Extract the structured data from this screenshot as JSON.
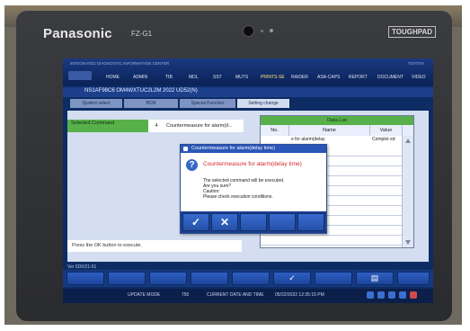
{
  "device": {
    "brand": "Panasonic",
    "model": "FZ-G1",
    "badge": "TOUGHPAD"
  },
  "app": {
    "title": "INTEGRATED DIAGNOSTIC INFORMATION CENTER",
    "top_right": "TOYOTA",
    "tabs": [
      "HOME",
      "ADMIN",
      "TIB",
      "MDL",
      "SST",
      "MUTS",
      "PRINTS-SE",
      "RAIDER",
      "ASA-CAPS",
      "REPORT",
      "DOCUMENT",
      "VIDEO"
    ],
    "active_tab": "PRINTS-SE"
  },
  "vehicle": {
    "text": "NS1AF98C6   OM4WXTUC2L2M 2022   UD52(N)"
  },
  "breadcrumbs": [
    "System select",
    "BCM",
    "Special Function",
    "Setting change"
  ],
  "selected_command": {
    "label": "Selected Command",
    "number": "4",
    "value": "Countermeasure for alarm(d..."
  },
  "data_list": {
    "title": "Data List",
    "columns": [
      "No.",
      "Name",
      "Value"
    ],
    "rows": [
      {
        "no": "",
        "name": "e for alarm(delay",
        "value": "Complet ed"
      },
      {
        "no": "",
        "name": "",
        "value": ""
      },
      {
        "no": "",
        "name": "",
        "value": ""
      },
      {
        "no": "",
        "name": "",
        "value": ""
      },
      {
        "no": "",
        "name": "",
        "value": ""
      },
      {
        "no": "",
        "name": "",
        "value": ""
      },
      {
        "no": "",
        "name": "",
        "value": ""
      },
      {
        "no": "",
        "name": "",
        "value": ""
      },
      {
        "no": "",
        "name": "",
        "value": ""
      },
      {
        "no": "",
        "name": "",
        "value": ""
      }
    ]
  },
  "instruction": "Press the OK button to execute.",
  "dialog": {
    "title": "Countermeasure for alarm(delay time)",
    "heading": "Countermeasure for alarm(delay time)",
    "lines": [
      "The selected command will be executed.",
      "Are you sure?",
      "Caution:",
      "Please check execution conditions."
    ]
  },
  "version": "Ver 5D0/21-01",
  "status": {
    "mode": "UPDATE MODE",
    "count": "750",
    "datetime_label": "CURRENT DATE AND TIME",
    "datetime": "05/22/2022 12:35:15 PM"
  },
  "colors": {
    "accent": "#58b04a",
    "alert": "#d3262a",
    "dialog_bar": "#2a56b8"
  }
}
